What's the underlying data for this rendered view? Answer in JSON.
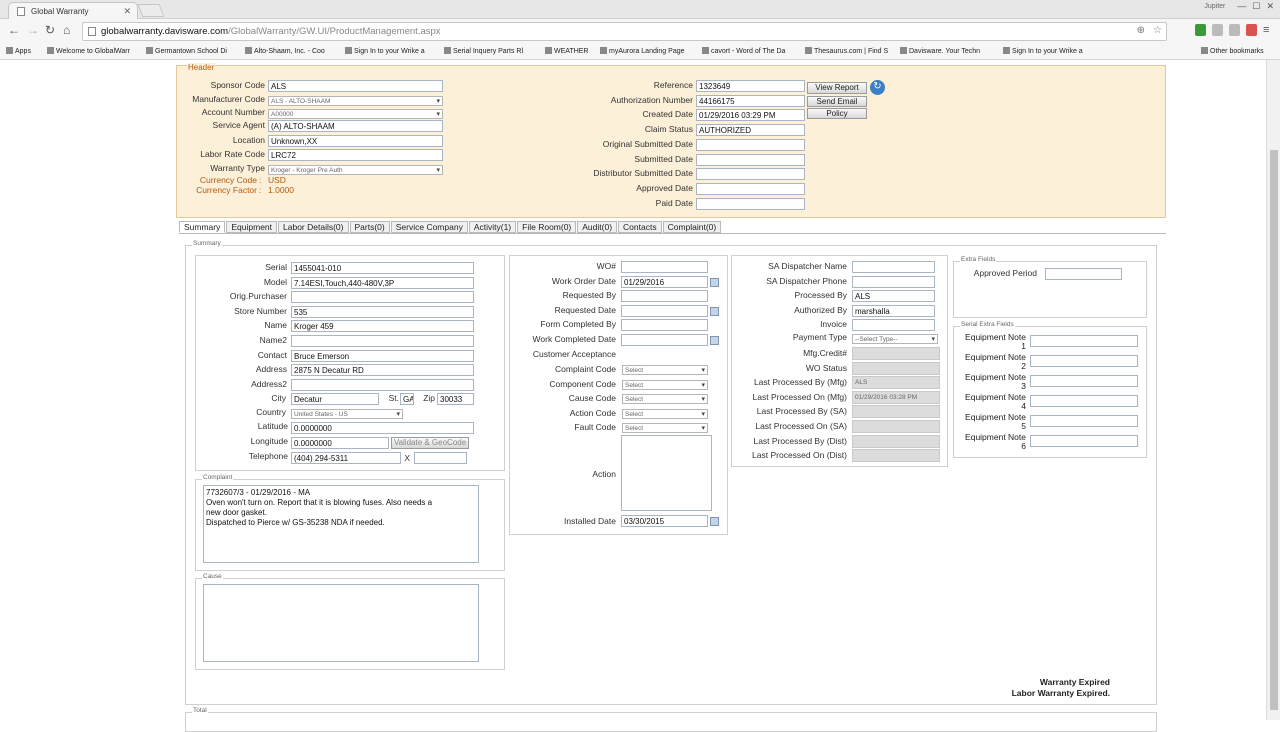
{
  "browser": {
    "tab_title": "Global Warranty",
    "url_domain": "globalwarranty.davisware.com",
    "url_path": "/GlobalWarranty/GW.UI/ProductManagement.aspx",
    "profile": "Jupiter",
    "bookmarks": [
      "Apps",
      "Welcome to GlobalWarr",
      "Germantown School Di",
      "Alto-Shaam, Inc. - Coo",
      "Sign In to your Wrike a",
      "Serial Inquery Parts Rl",
      "WEATHER",
      "myAurora Landing Page",
      "cavort - Word of The Da",
      "Thesaurus.com | Find S",
      "Davisware. Your Techn",
      "Sign In to your Wrike a",
      "Other bookmarks"
    ]
  },
  "header": {
    "legend": "Header",
    "left": [
      {
        "label": "Sponsor Code",
        "value": "ALS"
      },
      {
        "label": "Manufacturer Code",
        "value": "ALS - ALTO-SHAAM"
      },
      {
        "label": "Account Number",
        "value": "A00000"
      },
      {
        "label": "Service Agent",
        "value": "(A) ALTO-SHAAM"
      },
      {
        "label": "Location",
        "value": "Unknown,XX"
      },
      {
        "label": "Labor Rate Code",
        "value": "LRC72"
      },
      {
        "label": "Warranty Type",
        "value": "Kroger - Kroger Pre Auth"
      }
    ],
    "currency_code_label": "Currency Code",
    "currency_code": "USD",
    "currency_factor_label": "Currency Factor",
    "currency_factor": "1.0000",
    "right": [
      {
        "label": "Reference",
        "value": "1323649"
      },
      {
        "label": "Authorization Number",
        "value": "44166175"
      },
      {
        "label": "Created Date",
        "value": "01/29/2016 03:29 PM"
      },
      {
        "label": "Claim Status",
        "value": "AUTHORIZED"
      },
      {
        "label": "Original Submitted Date",
        "value": ""
      },
      {
        "label": "Submitted Date",
        "value": ""
      },
      {
        "label": "Distributor Submitted Date",
        "value": ""
      },
      {
        "label": "Approved Date",
        "value": ""
      },
      {
        "label": "Paid Date",
        "value": ""
      }
    ],
    "buttons": {
      "view": "View Report",
      "email": "Send Email",
      "policy": "Policy"
    }
  },
  "tabs": [
    "Summary",
    "Equipment",
    "Labor Details(0)",
    "Parts(0)",
    "Service Company",
    "Activity(1)",
    "File Room(0)",
    "Audit(0)",
    "Contacts",
    "Complaint(0)"
  ],
  "summary": {
    "legend": "Summary",
    "customer": [
      {
        "label": "Serial",
        "value": "1455041-010"
      },
      {
        "label": "Model",
        "value": "7.14ESI,Touch,440-480V,3P"
      },
      {
        "label": "Orig.Purchaser",
        "value": ""
      },
      {
        "label": "Store Number",
        "value": "535"
      },
      {
        "label": "Name",
        "value": "Kroger 459"
      },
      {
        "label": "Name2",
        "value": ""
      },
      {
        "label": "Contact",
        "value": "Bruce Emerson"
      },
      {
        "label": "Address",
        "value": "2875 N Decatur RD"
      },
      {
        "label": "Address2",
        "value": ""
      }
    ],
    "city_label": "City",
    "city": "Decatur",
    "st_label": "St.",
    "st": "GA",
    "zip_label": "Zip",
    "zip": "30033",
    "country_label": "Country",
    "country": "United States - US",
    "lat_label": "Latitude",
    "lat": "0.0000000",
    "lon_label": "Longitude",
    "lon": "0.0000000",
    "validate": "Validate & GeoCode",
    "tel_label": "Telephone",
    "tel": "(404) 294-5311",
    "ext_label": "X",
    "complaint_legend": "Complaint",
    "complaint": "7732607/3 - 01/29/2016 - MA\nOven won't turn on. Report that it is blowing fuses. Also needs a\nnew door gasket.\nDispatched to Pierce w/ GS-35238 NDA if needed.",
    "cause_legend": "Cause",
    "wo": [
      {
        "label": "WO#",
        "value": ""
      },
      {
        "label": "Work Order Date",
        "value": "01/29/2016"
      },
      {
        "label": "Requested By",
        "value": ""
      },
      {
        "label": "Requested Date",
        "value": ""
      },
      {
        "label": "Form Completed By",
        "value": ""
      },
      {
        "label": "Work Completed Date",
        "value": ""
      },
      {
        "label": "Customer Acceptance",
        "value": ""
      }
    ],
    "codes": [
      {
        "label": "Complaint Code",
        "value": "Select"
      },
      {
        "label": "Component Code",
        "value": "Select"
      },
      {
        "label": "Cause Code",
        "value": "Select"
      },
      {
        "label": "Action Code",
        "value": "Select"
      },
      {
        "label": "Fault Code",
        "value": "Select"
      }
    ],
    "action_label": "Action",
    "installed_label": "Installed Date",
    "installed": "03/30/2015",
    "dispatch": [
      {
        "label": "SA Dispatcher Name",
        "value": ""
      },
      {
        "label": "SA Dispatcher Phone",
        "value": ""
      },
      {
        "label": "Processed By",
        "value": "ALS"
      },
      {
        "label": "Authorized By",
        "value": "marshalla"
      },
      {
        "label": "Invoice",
        "value": ""
      }
    ],
    "payment_label": "Payment Type",
    "payment": "--Select Type--",
    "proc": [
      {
        "label": "Mfg.Credit#",
        "value": ""
      },
      {
        "label": "WO Status",
        "value": ""
      },
      {
        "label": "Last Processed By (Mfg)",
        "value": "ALS"
      },
      {
        "label": "Last Processed On (Mfg)",
        "value": "01/29/2016 03:28 PM"
      },
      {
        "label": "Last Processed By (SA)",
        "value": ""
      },
      {
        "label": "Last Processed On (SA)",
        "value": ""
      },
      {
        "label": "Last Processed By (Dist)",
        "value": ""
      },
      {
        "label": "Last Processed On (Dist)",
        "value": ""
      }
    ],
    "extra_legend": "Extra Fields",
    "approved_period": "Approved Period",
    "serial_legend": "Serial Extra Fields",
    "equip_notes": [
      {
        "label": "Equipment Note",
        "num": "1"
      },
      {
        "label": "Equipment Note",
        "num": "2"
      },
      {
        "label": "Equipment Note",
        "num": "3"
      },
      {
        "label": "Equipment Note",
        "num": "4"
      },
      {
        "label": "Equipment Note",
        "num": "5"
      },
      {
        "label": "Equipment Note",
        "num": "6"
      }
    ],
    "expired1": "Warranty Expired",
    "expired2": "Labor Warranty Expired.",
    "total_legend": "Total"
  }
}
